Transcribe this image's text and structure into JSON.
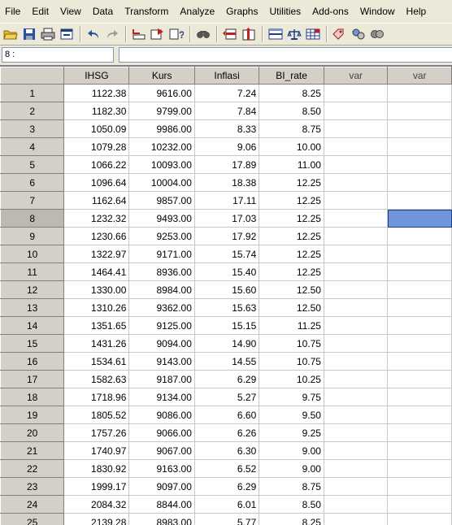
{
  "menu": [
    "File",
    "Edit",
    "View",
    "Data",
    "Transform",
    "Analyze",
    "Graphs",
    "Utilities",
    "Add-ons",
    "Window",
    "Help"
  ],
  "toolbar_icons": [
    "open-folder-icon",
    "save-icon",
    "print-icon",
    "dialog-recall-icon",
    "undo-icon",
    "redo-icon",
    "goto-case-icon",
    "goto-variable-icon",
    "variables-icon",
    "find-icon",
    "insert-cases-icon",
    "insert-variable-icon",
    "split-file-icon",
    "weight-cases-icon",
    "select-cases-icon",
    "value-labels-icon",
    "use-sets-icon",
    "show-all-icon"
  ],
  "editor": {
    "cell_ref": "8 :",
    "cell_value": ""
  },
  "grid": {
    "columns": [
      "IHSG",
      "Kurs",
      "Inflasi",
      "BI_rate",
      "var",
      "var"
    ],
    "rows": [
      {
        "n": "1",
        "v": [
          "1122.38",
          "9616.00",
          "7.24",
          "8.25"
        ]
      },
      {
        "n": "2",
        "v": [
          "1182.30",
          "9799.00",
          "7.84",
          "8.50"
        ]
      },
      {
        "n": "3",
        "v": [
          "1050.09",
          "9986.00",
          "8.33",
          "8.75"
        ]
      },
      {
        "n": "4",
        "v": [
          "1079.28",
          "10232.00",
          "9.06",
          "10.00"
        ]
      },
      {
        "n": "5",
        "v": [
          "1066.22",
          "10093.00",
          "17.89",
          "11.00"
        ]
      },
      {
        "n": "6",
        "v": [
          "1096.64",
          "10004.00",
          "18.38",
          "12.25"
        ]
      },
      {
        "n": "7",
        "v": [
          "1162.64",
          "9857.00",
          "17.11",
          "12.25"
        ]
      },
      {
        "n": "8",
        "v": [
          "1232.32",
          "9493.00",
          "17.03",
          "12.25"
        ]
      },
      {
        "n": "9",
        "v": [
          "1230.66",
          "9253.00",
          "17.92",
          "12.25"
        ]
      },
      {
        "n": "10",
        "v": [
          "1322.97",
          "9171.00",
          "15.74",
          "12.25"
        ]
      },
      {
        "n": "11",
        "v": [
          "1464.41",
          "8936.00",
          "15.40",
          "12.25"
        ]
      },
      {
        "n": "12",
        "v": [
          "1330.00",
          "8984.00",
          "15.60",
          "12.50"
        ]
      },
      {
        "n": "13",
        "v": [
          "1310.26",
          "9362.00",
          "15.63",
          "12.50"
        ]
      },
      {
        "n": "14",
        "v": [
          "1351.65",
          "9125.00",
          "15.15",
          "11.25"
        ]
      },
      {
        "n": "15",
        "v": [
          "1431.26",
          "9094.00",
          "14.90",
          "10.75"
        ]
      },
      {
        "n": "16",
        "v": [
          "1534.61",
          "9143.00",
          "14.55",
          "10.75"
        ]
      },
      {
        "n": "17",
        "v": [
          "1582.63",
          "9187.00",
          "6.29",
          "10.25"
        ]
      },
      {
        "n": "18",
        "v": [
          "1718.96",
          "9134.00",
          "5.27",
          "9.75"
        ]
      },
      {
        "n": "19",
        "v": [
          "1805.52",
          "9086.00",
          "6.60",
          "9.50"
        ]
      },
      {
        "n": "20",
        "v": [
          "1757.26",
          "9066.00",
          "6.26",
          "9.25"
        ]
      },
      {
        "n": "21",
        "v": [
          "1740.97",
          "9067.00",
          "6.30",
          "9.00"
        ]
      },
      {
        "n": "22",
        "v": [
          "1830.92",
          "9163.00",
          "6.52",
          "9.00"
        ]
      },
      {
        "n": "23",
        "v": [
          "1999.17",
          "9097.00",
          "6.29",
          "8.75"
        ]
      },
      {
        "n": "24",
        "v": [
          "2084.32",
          "8844.00",
          "6.01",
          "8.50"
        ]
      },
      {
        "n": "25",
        "v": [
          "2139.28",
          "8983.00",
          "5.77",
          "8.25"
        ]
      }
    ],
    "selected_row": "8"
  }
}
